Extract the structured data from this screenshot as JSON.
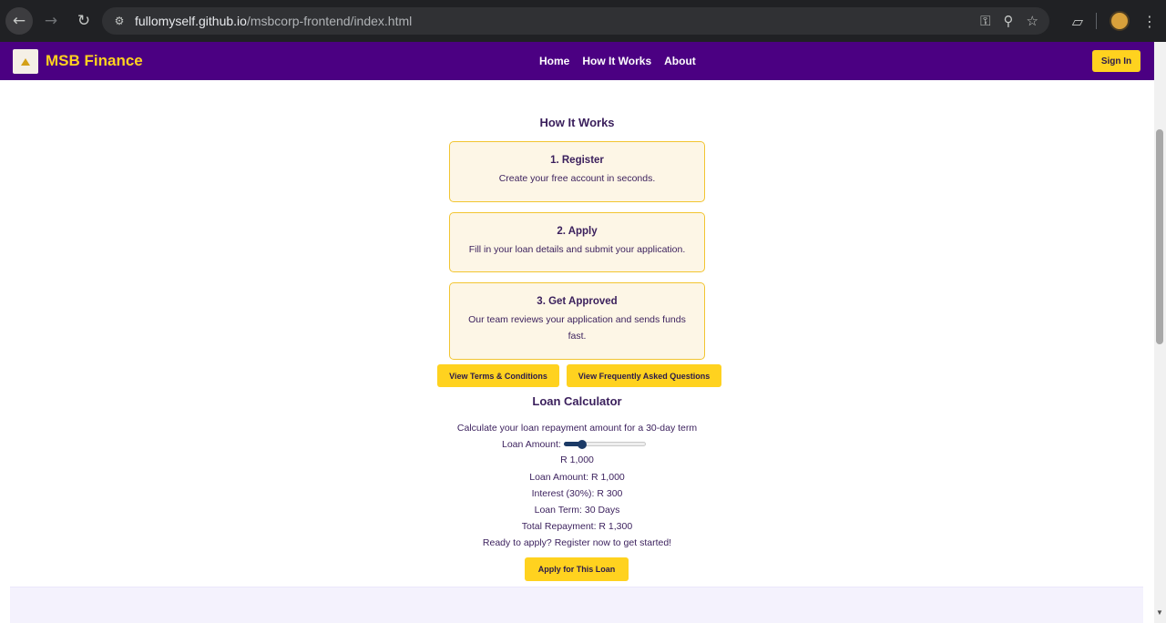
{
  "browser": {
    "url_host": "fullomyself.github.io",
    "url_path": "/msbcorp-frontend/index.html",
    "icons": {
      "back": "back-arrow-icon",
      "forward": "forward-arrow-icon",
      "reload": "reload-icon",
      "site": "site-settings-icon",
      "password": "key-icon",
      "zoom": "zoom-icon",
      "bookmark": "star-icon",
      "extensions": "puzzle-icon",
      "menu": "kebab-menu-icon"
    }
  },
  "header": {
    "brand": "MSB Finance",
    "nav": [
      "Home",
      "How It Works",
      "About"
    ],
    "signin_label": "Sign In",
    "colors": {
      "bar": "#4b0082",
      "accent": "#ffd21f"
    }
  },
  "how_it_works": {
    "title": "How It Works",
    "steps": [
      {
        "title": "1. Register",
        "desc": "Create your free account in seconds."
      },
      {
        "title": "2. Apply",
        "desc": "Fill in your loan details and submit your application."
      },
      {
        "title": "3. Get Approved",
        "desc": "Our team reviews your application and sends funds fast."
      }
    ],
    "terms_label": "View Terms & Conditions",
    "faq_label": "View Frequently Asked Questions"
  },
  "calculator": {
    "title": "Loan Calculator",
    "subtitle": "Calculate your loan repayment amount for a 30-day term",
    "slider_label": "Loan Amount:",
    "slider_fraction": 0.22,
    "amount_display": "R 1,000",
    "loan_amount_line": "Loan Amount: R 1,000",
    "interest_line": "Interest (30%): R 300",
    "term_line": "Loan Term: 30 Days",
    "total_line": "Total Repayment: R 1,300",
    "cta_text": "Ready to apply? Register now to get started!",
    "apply_label": "Apply for This Loan"
  }
}
